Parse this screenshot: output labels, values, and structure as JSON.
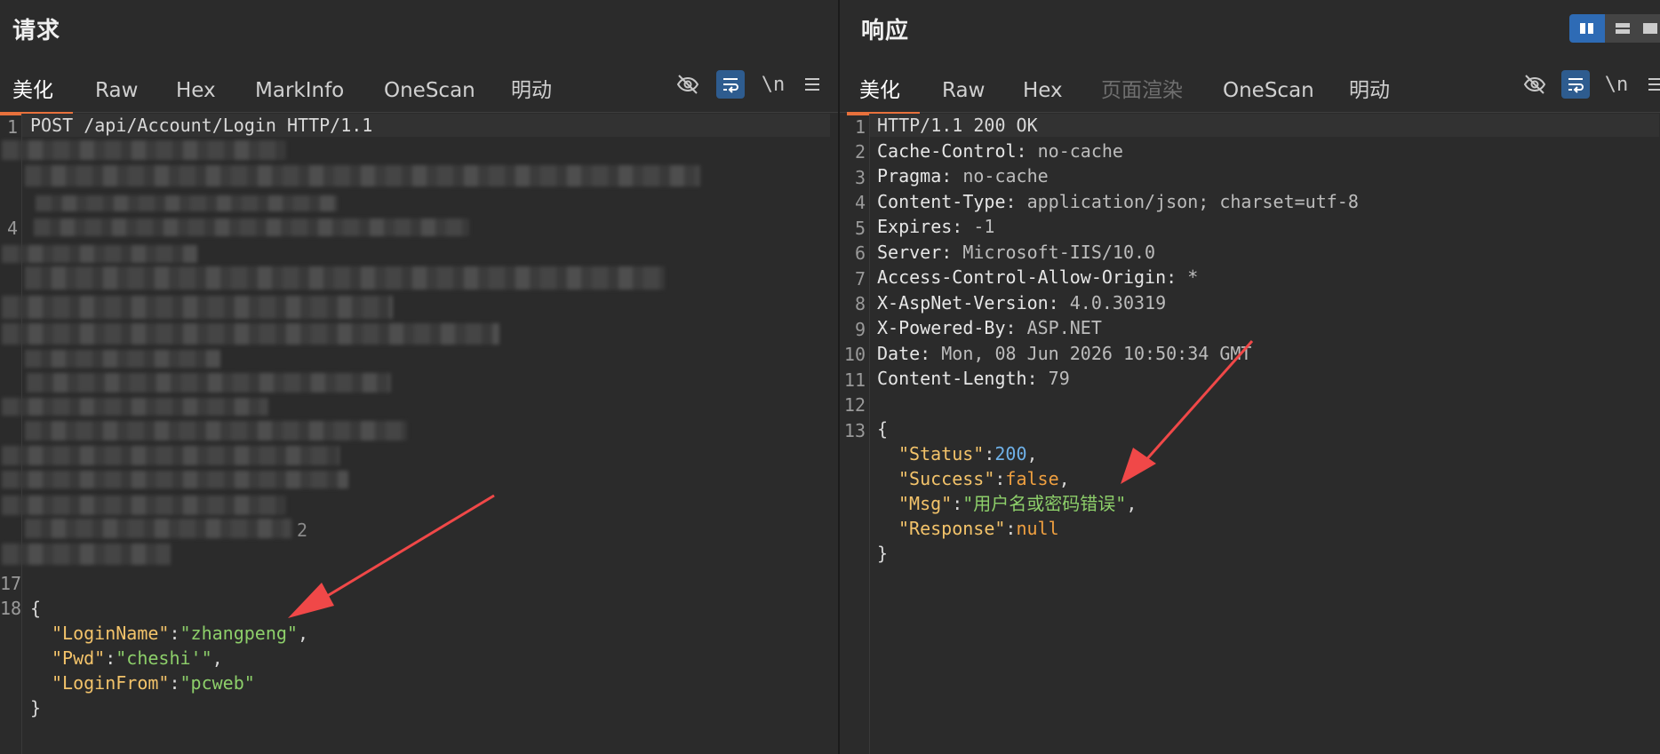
{
  "request": {
    "title": "请求",
    "tabs": [
      "美化",
      "Raw",
      "Hex",
      "MarkInfo",
      "OneScan",
      "明动"
    ],
    "active_tab": "美化",
    "tool_newline": "\\n",
    "line_numbers": [
      "1",
      "4",
      "17",
      "18"
    ],
    "request_line": "POST /api/Account/Login HTTP/1.1",
    "body": {
      "open": "{",
      "login_name_key": "\"LoginName\"",
      "login_name_val": "\"zhangpeng\"",
      "pwd_key": "\"Pwd\"",
      "pwd_val": "\"cheshi'\"",
      "login_from_key": "\"LoginFrom\"",
      "login_from_val": "\"pcweb\"",
      "close": "}"
    },
    "blurred_fragment": "2"
  },
  "response": {
    "title": "响应",
    "tabs": [
      "美化",
      "Raw",
      "Hex",
      "页面渲染",
      "OneScan",
      "明动"
    ],
    "active_tab": "美化",
    "disabled_tab": "页面渲染",
    "tool_newline": "\\n",
    "line_numbers": [
      "1",
      "2",
      "3",
      "4",
      "5",
      "6",
      "7",
      "8",
      "9",
      "10",
      "11",
      "12",
      "13"
    ],
    "status_line": "HTTP/1.1 200 OK",
    "headers": [
      {
        "name": "Cache-Control",
        "value": " no-cache"
      },
      {
        "name": "Pragma",
        "value": " no-cache"
      },
      {
        "name": "Content-Type",
        "value": " application/json; charset=utf-8"
      },
      {
        "name": "Expires",
        "value": " -1"
      },
      {
        "name": "Server",
        "value": " Microsoft-IIS/10.0"
      },
      {
        "name": "Access-Control-Allow-Origin",
        "value": " *"
      },
      {
        "name": "X-AspNet-Version",
        "value": " 4.0.30319"
      },
      {
        "name": "X-Powered-By",
        "value": " ASP.NET"
      },
      {
        "name": "Date",
        "value": " Mon, 08 Jun 2026 10:50:34 GMT"
      },
      {
        "name": "Content-Length",
        "value": " 79"
      }
    ],
    "body": {
      "open": "{",
      "status_key": "\"Status\"",
      "status_val": "200",
      "success_key": "\"Success\"",
      "success_val": "false",
      "msg_key": "\"Msg\"",
      "msg_val": "\"用户名或密码错误\"",
      "response_key": "\"Response\"",
      "response_val": "null",
      "close": "}"
    }
  },
  "colors": {
    "accent_tab": "#e8713c",
    "json_key": "#f3c36a",
    "json_string": "#8dcf6a",
    "json_number": "#6fb1e8",
    "json_literal": "#f0a040",
    "arrow": "#f04848",
    "toolbar_active": "#2e5c8f"
  },
  "icons": [
    "hide-icon",
    "wrap-icon",
    "newline-icon",
    "menu-icon",
    "layout-split-icon",
    "layout-rows-icon",
    "layout-single-icon"
  ]
}
